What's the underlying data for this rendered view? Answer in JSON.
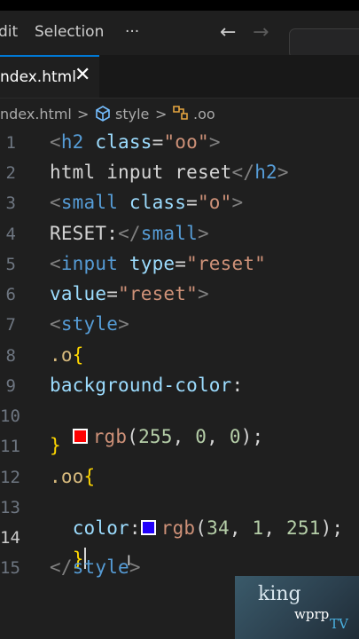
{
  "menubar": {
    "items": [
      "dit",
      "Selection",
      "···"
    ],
    "back": "←",
    "forward": "→"
  },
  "tab": {
    "label": "ndex.html",
    "close": "✕"
  },
  "breadcrumb": {
    "file": "ndex.html",
    "sep": ">",
    "style_label": "style",
    "selector_label": ".oo"
  },
  "gutter": [
    "1",
    "2",
    "3",
    "4",
    "5",
    "6",
    "7",
    "8",
    "9",
    "10",
    "11",
    "12",
    "13",
    "14",
    "15"
  ],
  "code": {
    "l1": [
      [
        "t-gray",
        "<"
      ],
      [
        "t-blue",
        "h2"
      ],
      [
        "t-text",
        " "
      ],
      [
        "t-attr",
        "class"
      ],
      [
        "t-text",
        "="
      ],
      [
        "t-str",
        "\"oo\""
      ],
      [
        "t-gray",
        ">"
      ]
    ],
    "l2": [
      [
        "t-text",
        "html input reset"
      ],
      [
        "t-gray",
        "</"
      ],
      [
        "t-blue",
        "h2"
      ],
      [
        "t-gray",
        ">"
      ]
    ],
    "l3": [
      [
        "t-gray",
        "<"
      ],
      [
        "t-blue",
        "small"
      ],
      [
        "t-text",
        " "
      ],
      [
        "t-attr",
        "class"
      ],
      [
        "t-text",
        "="
      ],
      [
        "t-str",
        "\"o\""
      ],
      [
        "t-gray",
        ">"
      ]
    ],
    "l4": [
      [
        "t-text",
        "RESET:"
      ],
      [
        "t-gray",
        "</"
      ],
      [
        "t-blue",
        "small"
      ],
      [
        "t-gray",
        ">"
      ]
    ],
    "l5": [
      [
        "t-gray",
        "<"
      ],
      [
        "t-blue",
        "input"
      ],
      [
        "t-text",
        " "
      ],
      [
        "t-attr",
        "type"
      ],
      [
        "t-text",
        "="
      ],
      [
        "t-str",
        "\"reset\""
      ]
    ],
    "l6": [
      [
        "t-attr",
        "value"
      ],
      [
        "t-text",
        "="
      ],
      [
        "t-str",
        "\"reset\""
      ],
      [
        "t-gray",
        ">"
      ]
    ],
    "l7": [
      [
        "t-gray",
        "<"
      ],
      [
        "t-blue",
        "style"
      ],
      [
        "t-gray",
        ">"
      ]
    ],
    "l8": [
      [
        "t-sel",
        ".o"
      ],
      [
        "t-brace",
        "{"
      ]
    ],
    "l9": [
      [
        "t-attr",
        "background-color"
      ],
      [
        "t-text",
        ":"
      ]
    ],
    "l10": [
      [
        "t-str",
        "rgb"
      ],
      [
        "t-text",
        "("
      ],
      [
        "t-num",
        "255"
      ],
      [
        "t-text",
        ", "
      ],
      [
        "t-num",
        "0"
      ],
      [
        "t-text",
        ", "
      ],
      [
        "t-num",
        "0"
      ],
      [
        "t-text",
        ");"
      ]
    ],
    "l11": [
      [
        "t-brace",
        "}"
      ]
    ],
    "l12": [
      [
        "t-sel",
        ".oo"
      ],
      [
        "t-brace",
        "{"
      ]
    ],
    "l13": [
      [
        "t-attr",
        "color"
      ],
      [
        "t-text",
        ":"
      ]
    ],
    "l13b": [
      [
        "t-str",
        "rgb"
      ],
      [
        "t-text",
        "("
      ],
      [
        "t-num",
        "34"
      ],
      [
        "t-text",
        ", "
      ],
      [
        "t-num",
        "1"
      ],
      [
        "t-text",
        ", "
      ],
      [
        "t-num",
        "251"
      ],
      [
        "t-text",
        ");"
      ]
    ],
    "l14": [
      [
        "t-brace",
        "}"
      ]
    ],
    "l15": [
      [
        "t-gray",
        "</"
      ],
      [
        "t-blue",
        "style"
      ],
      [
        "t-gray",
        ">"
      ]
    ]
  },
  "swatches": {
    "red": "#ff0000",
    "blue": "#2201fb"
  },
  "mouse_cursor": "I",
  "watermark": {
    "line1": "king",
    "line2": "wprp",
    "line3": "TV"
  }
}
